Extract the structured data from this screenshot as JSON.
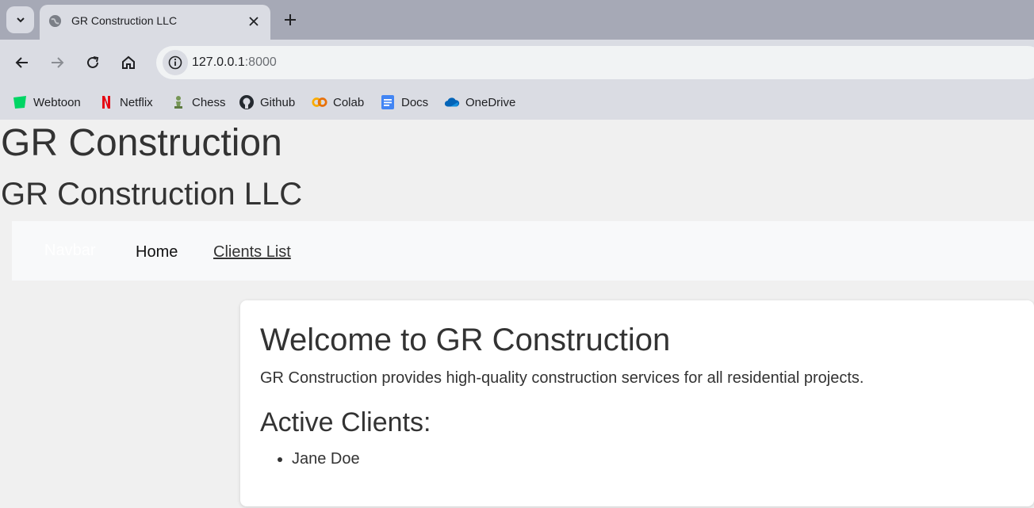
{
  "browser": {
    "tab_title": "GR Construction LLC",
    "url_host": "127.0.0.1",
    "url_port": ":8000",
    "bookmarks": [
      {
        "label": "Webtoon",
        "icon": "webtoon-icon",
        "color": "#00d564"
      },
      {
        "label": "Netflix",
        "icon": "netflix-icon",
        "color": "#e50914"
      },
      {
        "label": "Chess",
        "icon": "chess-icon",
        "color": "#769656"
      },
      {
        "label": "Github",
        "icon": "github-icon",
        "color": "#24292f"
      },
      {
        "label": "Colab",
        "icon": "colab-icon",
        "color": "#f9ab00"
      },
      {
        "label": "Docs",
        "icon": "docs-icon",
        "color": "#4285f4"
      },
      {
        "label": "OneDrive",
        "icon": "onedrive-icon",
        "color": "#0364b8"
      }
    ]
  },
  "page": {
    "heading": "GR Construction",
    "subheading": "GR Construction LLC",
    "navbar": {
      "brand": "Navbar",
      "links": [
        "Home",
        "Clients List"
      ]
    },
    "card": {
      "title": "Welcome to GR Construction",
      "description": "GR Construction provides high-quality construction services for all residential projects.",
      "clients_heading": "Active Clients:",
      "clients": [
        "Jane Doe"
      ]
    }
  }
}
